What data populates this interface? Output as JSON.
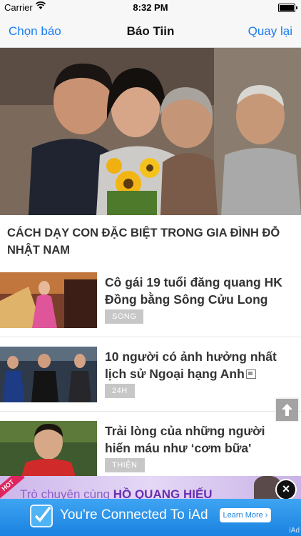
{
  "status_bar": {
    "carrier": "Carrier",
    "time": "8:32 PM"
  },
  "nav": {
    "left_button": "Chọn báo",
    "title": "Báo Tiin",
    "right_button": "Quay lại"
  },
  "headline": "CÁCH DẠY CON ĐẶC BIỆT TRONG GIA ĐÌNH ĐỖ NHẬT NAM",
  "articles": [
    {
      "title": "Cô gái 19 tuổi đăng quang HK Đồng bằng Sông Cửu Long",
      "tag": "SÓNG"
    },
    {
      "title": "10 người có ảnh hưởng nhất lịch sử Ngoại hạng Anh",
      "tag": "24H"
    },
    {
      "title": "Trải lòng của những người hiến máu như ‘cơm bữa'",
      "tag": "THIỆN"
    }
  ],
  "ad": {
    "hot_label": "HOT",
    "promo_prefix": "Trò chuyện cùng ",
    "promo_name": "HỒ QUANG HIẾU",
    "close": "×",
    "banner_text": "You're Connected To iAd",
    "button_label": "Learn More ›",
    "iad_label": "iAd"
  },
  "colors": {
    "accent": "#1a7cf2",
    "tag_bg": "#c7c7c7",
    "iad_blue": "#1a82e0"
  }
}
